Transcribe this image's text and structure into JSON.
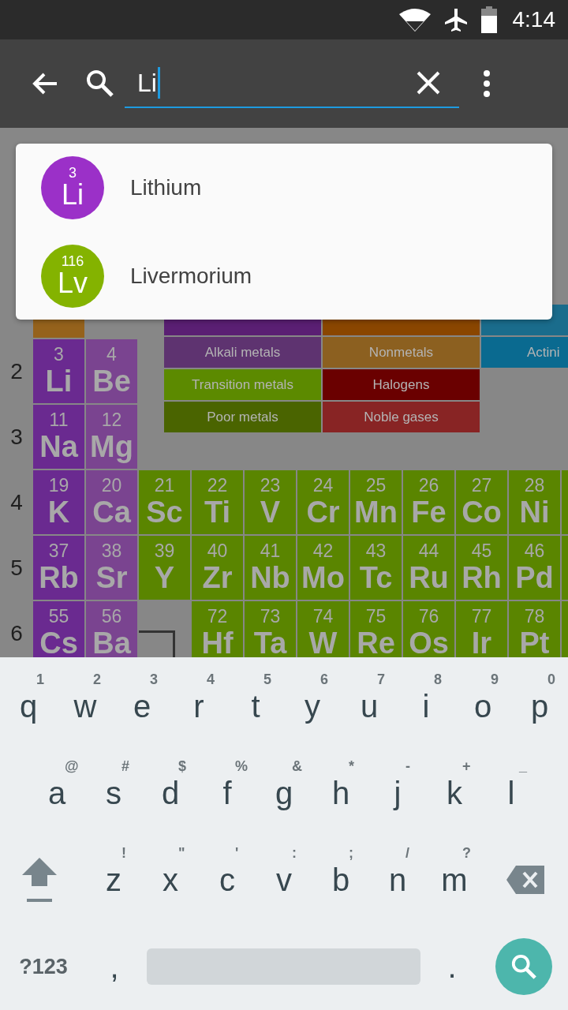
{
  "status_bar": {
    "time": "4:14"
  },
  "search": {
    "value": "Li"
  },
  "suggestions": [
    {
      "number": "3",
      "symbol": "Li",
      "name": "Lithium",
      "color": "#9b30c8"
    },
    {
      "number": "116",
      "symbol": "Lv",
      "name": "Livermorium",
      "color": "#84b300"
    }
  ],
  "legend": {
    "rows": [
      {
        "items": [
          {
            "color": "#5a1f73"
          },
          {
            "color": "#8a4600"
          },
          {
            "color": "#1a6c8c"
          }
        ]
      },
      {
        "items": [
          {
            "label": "Alkali metals",
            "color": "#5e3370"
          },
          {
            "label": "Nonmetals",
            "color": "#8c6020"
          },
          {
            "label": "Actini",
            "color": "#0a6a90"
          }
        ]
      },
      {
        "items": [
          {
            "label": "Transition metals",
            "color": "#5c8a00"
          },
          {
            "label": "Halogens",
            "color": "#6a0000"
          }
        ]
      },
      {
        "items": [
          {
            "label": "Poor metals",
            "color": "#4a6400"
          },
          {
            "label": "Noble gases",
            "color": "#882424"
          }
        ]
      }
    ]
  },
  "table": {
    "rows": [
      {
        "cells": [
          {
            "kind": "element",
            "color": "#95621c"
          }
        ]
      },
      {
        "label": "2",
        "cells": [
          {
            "kind": "element",
            "number": "3",
            "symbol": "Li",
            "color": "#6a2a90"
          },
          {
            "kind": "element",
            "number": "4",
            "symbol": "Be",
            "color": "#7a4490"
          }
        ]
      },
      {
        "label": "3",
        "cells": [
          {
            "kind": "element",
            "number": "11",
            "symbol": "Na",
            "color": "#6a2a90"
          },
          {
            "kind": "element",
            "number": "12",
            "symbol": "Mg",
            "color": "#7a4490"
          }
        ]
      },
      {
        "label": "4",
        "cells": [
          {
            "kind": "element",
            "number": "19",
            "symbol": "K",
            "color": "#6a2a90"
          },
          {
            "kind": "element",
            "number": "20",
            "symbol": "Ca",
            "color": "#7a4490"
          },
          {
            "kind": "element",
            "number": "21",
            "symbol": "Sc",
            "color": "#5a8500"
          },
          {
            "kind": "element",
            "number": "22",
            "symbol": "Ti",
            "color": "#5a8500"
          },
          {
            "kind": "element",
            "number": "23",
            "symbol": "V",
            "color": "#5a8500"
          },
          {
            "kind": "element",
            "number": "24",
            "symbol": "Cr",
            "color": "#5a8500"
          },
          {
            "kind": "element",
            "number": "25",
            "symbol": "Mn",
            "color": "#5a8500"
          },
          {
            "kind": "element",
            "number": "26",
            "symbol": "Fe",
            "color": "#5a8500"
          },
          {
            "kind": "element",
            "number": "27",
            "symbol": "Co",
            "color": "#5a8500"
          },
          {
            "kind": "element",
            "number": "28",
            "symbol": "Ni",
            "color": "#5a8500"
          },
          {
            "kind": "element",
            "color": "#5a8500"
          }
        ]
      },
      {
        "label": "5",
        "cells": [
          {
            "kind": "element",
            "number": "37",
            "symbol": "Rb",
            "color": "#6a2a90"
          },
          {
            "kind": "element",
            "number": "38",
            "symbol": "Sr",
            "color": "#7a4490"
          },
          {
            "kind": "element",
            "number": "39",
            "symbol": "Y",
            "color": "#5a8500"
          },
          {
            "kind": "element",
            "number": "40",
            "symbol": "Zr",
            "color": "#5a8500"
          },
          {
            "kind": "element",
            "number": "41",
            "symbol": "Nb",
            "color": "#5a8500"
          },
          {
            "kind": "element",
            "number": "42",
            "symbol": "Mo",
            "color": "#5a8500"
          },
          {
            "kind": "element",
            "number": "43",
            "symbol": "Tc",
            "color": "#5a8500"
          },
          {
            "kind": "element",
            "number": "44",
            "symbol": "Ru",
            "color": "#5a8500"
          },
          {
            "kind": "element",
            "number": "45",
            "symbol": "Rh",
            "color": "#5a8500"
          },
          {
            "kind": "element",
            "number": "46",
            "symbol": "Pd",
            "color": "#5a8500"
          },
          {
            "kind": "element",
            "color": "#5a8500"
          }
        ]
      },
      {
        "label": "6",
        "cells": [
          {
            "kind": "element",
            "number": "55",
            "symbol": "Cs",
            "color": "#6a2a90"
          },
          {
            "kind": "element",
            "number": "56",
            "symbol": "Ba",
            "color": "#7a4490"
          },
          {
            "kind": "bracket"
          },
          {
            "kind": "element",
            "number": "72",
            "symbol": "Hf",
            "color": "#5a8500"
          },
          {
            "kind": "element",
            "number": "73",
            "symbol": "Ta",
            "color": "#5a8500"
          },
          {
            "kind": "element",
            "number": "74",
            "symbol": "W",
            "color": "#5a8500"
          },
          {
            "kind": "element",
            "number": "75",
            "symbol": "Re",
            "color": "#5a8500"
          },
          {
            "kind": "element",
            "number": "76",
            "symbol": "Os",
            "color": "#5a8500"
          },
          {
            "kind": "element",
            "number": "77",
            "symbol": "Ir",
            "color": "#5a8500"
          },
          {
            "kind": "element",
            "number": "78",
            "symbol": "Pt",
            "color": "#5a8500"
          },
          {
            "kind": "element",
            "color": "#5a8500"
          }
        ]
      }
    ]
  },
  "keyboard": {
    "rows": [
      {
        "keys": [
          {
            "label": "q",
            "hint": "1"
          },
          {
            "label": "w",
            "hint": "2"
          },
          {
            "label": "e",
            "hint": "3"
          },
          {
            "label": "r",
            "hint": "4"
          },
          {
            "label": "t",
            "hint": "5"
          },
          {
            "label": "y",
            "hint": "6"
          },
          {
            "label": "u",
            "hint": "7"
          },
          {
            "label": "i",
            "hint": "8"
          },
          {
            "label": "o",
            "hint": "9"
          },
          {
            "label": "p",
            "hint": "0"
          }
        ]
      },
      {
        "keys": [
          {
            "label": "a",
            "hint": "@"
          },
          {
            "label": "s",
            "hint": "#"
          },
          {
            "label": "d",
            "hint": "$"
          },
          {
            "label": "f",
            "hint": "%"
          },
          {
            "label": "g",
            "hint": "&"
          },
          {
            "label": "h",
            "hint": "*"
          },
          {
            "label": "j",
            "hint": "-"
          },
          {
            "label": "k",
            "hint": "+"
          },
          {
            "label": "l",
            "hint": "_"
          }
        ]
      },
      {
        "keys": [
          {
            "label": "z",
            "hint": "!"
          },
          {
            "label": "x",
            "hint": "\""
          },
          {
            "label": "c",
            "hint": "'"
          },
          {
            "label": "v",
            "hint": ":"
          },
          {
            "label": "b",
            "hint": ";"
          },
          {
            "label": "n",
            "hint": "/"
          },
          {
            "label": "m",
            "hint": "?"
          }
        ]
      }
    ],
    "symbols_key": "?123",
    "comma_key": ",",
    "period_key": "."
  }
}
